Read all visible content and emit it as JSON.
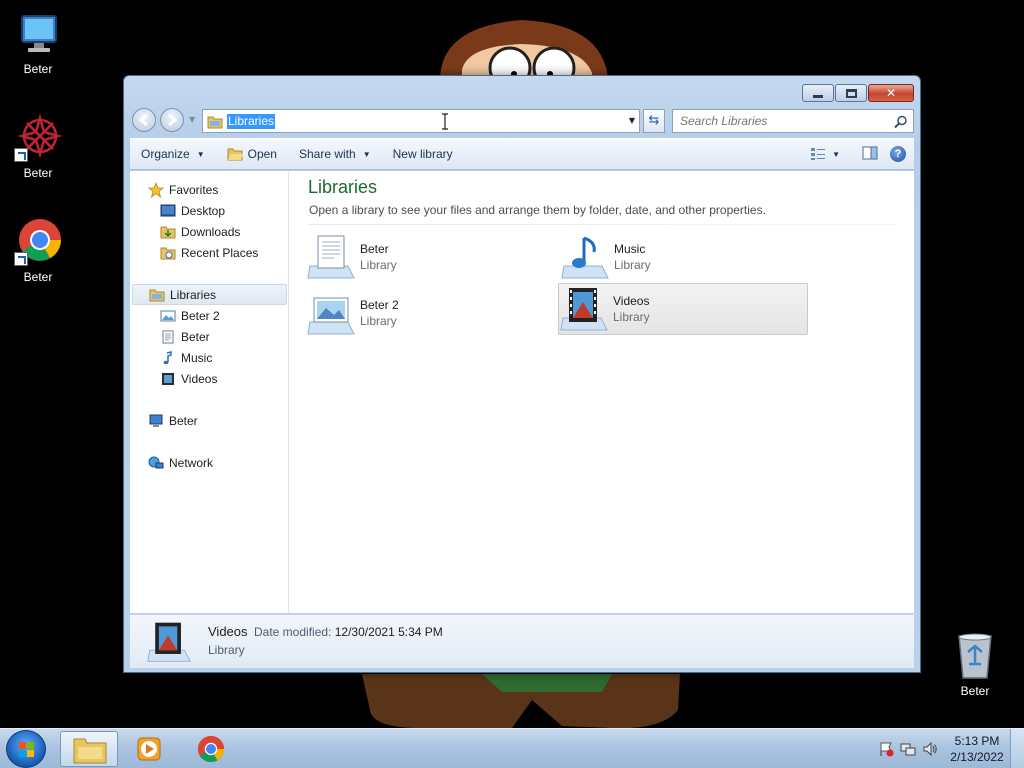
{
  "desktop": {
    "icons": [
      {
        "label": "Beter",
        "icon": "computer-icon"
      },
      {
        "label": "Beter",
        "icon": "app-shortcut-icon"
      },
      {
        "label": "Beter",
        "icon": "chrome-icon"
      },
      {
        "label": "Beter",
        "icon": "recycle-bin-icon"
      }
    ]
  },
  "window": {
    "address": "Libraries",
    "search_placeholder": "Search Libraries"
  },
  "commands": {
    "organize": "Organize",
    "open": "Open",
    "share_with": "Share with",
    "new_library": "New library"
  },
  "nav": {
    "favorites": "Favorites",
    "desktop": "Desktop",
    "downloads": "Downloads",
    "recent_places": "Recent Places",
    "libraries": "Libraries",
    "lib_items": [
      "Beter 2",
      "Beter",
      "Music",
      "Videos"
    ],
    "computer": "Beter",
    "network": "Network"
  },
  "main": {
    "title": "Libraries",
    "subtitle": "Open a library to see your files and arrange them by folder, date, and other properties.",
    "tiles": [
      {
        "name": "Beter",
        "kind": "Library",
        "icon": "documents-library-icon"
      },
      {
        "name": "Music",
        "kind": "Library",
        "icon": "music-library-icon"
      },
      {
        "name": "Beter 2",
        "kind": "Library",
        "icon": "pictures-library-icon"
      },
      {
        "name": "Videos",
        "kind": "Library",
        "icon": "videos-library-icon",
        "selected": true
      }
    ]
  },
  "details": {
    "name": "Videos",
    "meta_label": "Date modified:",
    "meta_value": "12/30/2021 5:34 PM",
    "kind": "Library"
  },
  "taskbar": {
    "time": "5:13 PM",
    "date": "2/13/2022",
    "colors": {
      "accent": "#3399ff",
      "title_green": "#1e6a34"
    }
  }
}
